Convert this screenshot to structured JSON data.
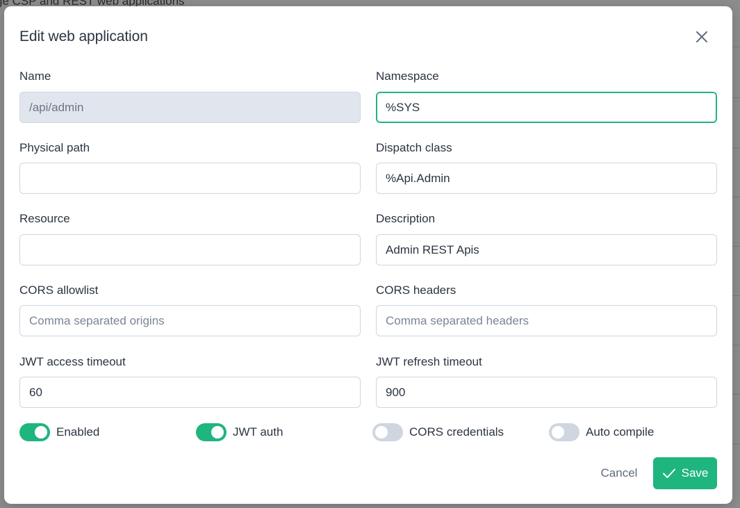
{
  "background": {
    "page_title": "ge CSP and REST web applications"
  },
  "dialog": {
    "title": "Edit web application",
    "close_icon": "close-icon"
  },
  "fields": {
    "name": {
      "label": "Name",
      "value": "/api/admin",
      "placeholder": "",
      "disabled": true
    },
    "namespace": {
      "label": "Namespace",
      "value": "%SYS",
      "placeholder": "",
      "focused": true
    },
    "physical_path": {
      "label": "Physical path",
      "value": "",
      "placeholder": ""
    },
    "dispatch_class": {
      "label": "Dispatch class",
      "value": "%Api.Admin",
      "placeholder": ""
    },
    "resource": {
      "label": "Resource",
      "value": "",
      "placeholder": ""
    },
    "description": {
      "label": "Description",
      "value": "Admin REST Apis",
      "placeholder": ""
    },
    "cors_allowlist": {
      "label": "CORS allowlist",
      "value": "",
      "placeholder": "Comma separated origins"
    },
    "cors_headers": {
      "label": "CORS headers",
      "value": "",
      "placeholder": "Comma separated headers"
    },
    "jwt_access_timeout": {
      "label": "JWT access timeout",
      "value": "60",
      "placeholder": ""
    },
    "jwt_refresh_timeout": {
      "label": "JWT refresh timeout",
      "value": "900",
      "placeholder": ""
    }
  },
  "toggles": {
    "enabled": {
      "label": "Enabled",
      "on": true
    },
    "jwt_auth": {
      "label": "JWT auth",
      "on": true
    },
    "cors_credentials": {
      "label": "CORS credentials",
      "on": false
    },
    "auto_compile": {
      "label": "Auto compile",
      "on": false
    }
  },
  "actions": {
    "cancel_label": "Cancel",
    "save_label": "Save",
    "save_icon": "check-icon"
  },
  "colors": {
    "accent": "#1fb57f",
    "toggle_off": "#cfd6df",
    "text": "#2b3441",
    "disabled_input_bg": "#e1e6ee"
  }
}
